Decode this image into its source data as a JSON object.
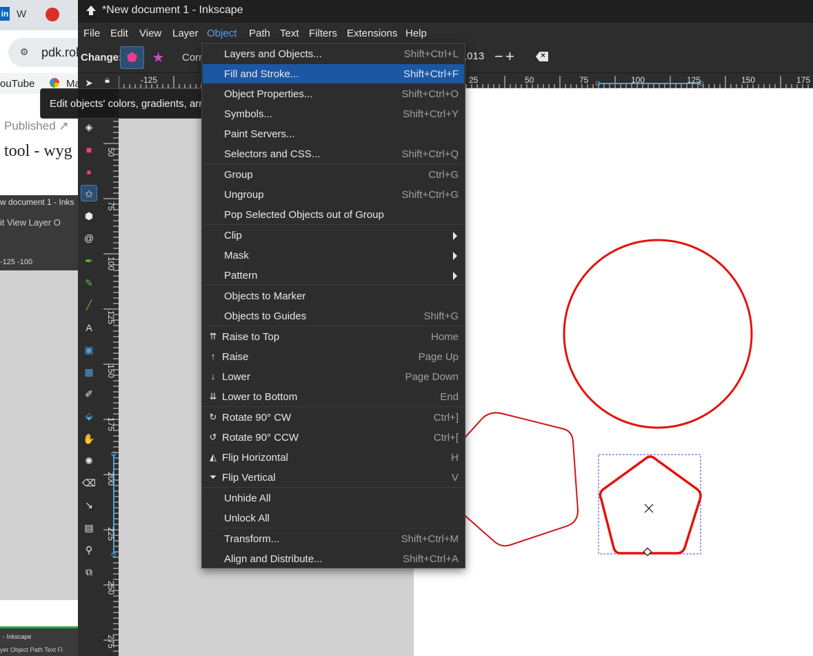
{
  "background_browser": {
    "tab_w": "W",
    "linkedin": "in",
    "address": "pdk.rol",
    "bookmark_youtube": "ouTube",
    "bookmark_maps": "Ma",
    "published": "Published ↗",
    "tool_heading": "tool - wyg",
    "inner_title": "w document 1 - Inks",
    "inner_menu": "it   View   Layer   O",
    "inner_ruler": "-125     -100",
    "inner_bottom_title": "- Inkscape",
    "inner_bottom_menu": "yer  Object  Path  Text  Fi"
  },
  "window": {
    "title": "*New document 1 - Inkscape"
  },
  "menubar": {
    "items": [
      "File",
      "Edit",
      "View",
      "Layer",
      "Object",
      "Path",
      "Text",
      "Filters",
      "Extensions",
      "Help"
    ],
    "active": "Object"
  },
  "tool_controls": {
    "change_label": "Change:",
    "corners_label": "Corr",
    "value": ",013",
    "minus": "−",
    "plus": "+"
  },
  "tooltip": {
    "text": "Edit objects' colors, gradients, arrowheads, and other fill and stroke properties..."
  },
  "rulers": {
    "horizontal": [
      "-125",
      "25",
      "50",
      "75",
      "100",
      "125",
      "150",
      "175"
    ],
    "vertical": [
      "50",
      "75",
      "100",
      "125",
      "150",
      "175",
      "200",
      "225",
      "250",
      "275"
    ]
  },
  "object_menu": {
    "items": [
      {
        "label": "Layers and Objects...",
        "shortcut": "Shift+Ctrl+L"
      },
      {
        "label": "Fill and Stroke...",
        "shortcut": "Shift+Ctrl+F",
        "highlighted": true
      },
      {
        "label": "Object Properties...",
        "shortcut": "Shift+Ctrl+O"
      },
      {
        "label": "Symbols...",
        "shortcut": "Shift+Ctrl+Y"
      },
      {
        "label": "Paint Servers...",
        "shortcut": ""
      },
      {
        "label": "Selectors and CSS...",
        "shortcut": "Shift+Ctrl+Q"
      },
      {
        "label": "Group",
        "shortcut": "Ctrl+G"
      },
      {
        "label": "Ungroup",
        "shortcut": "Shift+Ctrl+G"
      },
      {
        "label": "Pop Selected Objects out of Group",
        "shortcut": ""
      },
      {
        "label": "Clip",
        "shortcut": "",
        "submenu": true
      },
      {
        "label": "Mask",
        "shortcut": "",
        "submenu": true
      },
      {
        "label": "Pattern",
        "shortcut": "",
        "submenu": true
      },
      {
        "label": "Objects to Marker",
        "shortcut": ""
      },
      {
        "label": "Objects to Guides",
        "shortcut": "Shift+G"
      },
      {
        "label": "Raise to Top",
        "shortcut": "Home",
        "icon": "raise-to-top-icon"
      },
      {
        "label": "Raise",
        "shortcut": "Page Up",
        "icon": "raise-icon"
      },
      {
        "label": "Lower",
        "shortcut": "Page Down",
        "icon": "lower-icon"
      },
      {
        "label": "Lower to Bottom",
        "shortcut": "End",
        "icon": "lower-to-bottom-icon"
      },
      {
        "label": "Rotate 90° CW",
        "shortcut": "Ctrl+]",
        "icon": "rotate-cw-icon"
      },
      {
        "label": "Rotate 90° CCW",
        "shortcut": "Ctrl+[",
        "icon": "rotate-ccw-icon"
      },
      {
        "label": "Flip Horizontal",
        "shortcut": "H",
        "icon": "flip-horizontal-icon"
      },
      {
        "label": "Flip Vertical",
        "shortcut": "V",
        "icon": "flip-vertical-icon"
      },
      {
        "label": "Unhide All",
        "shortcut": ""
      },
      {
        "label": "Unlock All",
        "shortcut": ""
      },
      {
        "label": "Transform...",
        "shortcut": "Shift+Ctrl+M"
      },
      {
        "label": "Align and Distribute...",
        "shortcut": "Shift+Ctrl+A"
      }
    ]
  },
  "colors": {
    "accent": "#1b57a3",
    "shape_stroke": "#e3120b",
    "polygon_tool": "#f03c8c",
    "star_tool": "#c64bc4",
    "selection": "#4a3fd6"
  }
}
